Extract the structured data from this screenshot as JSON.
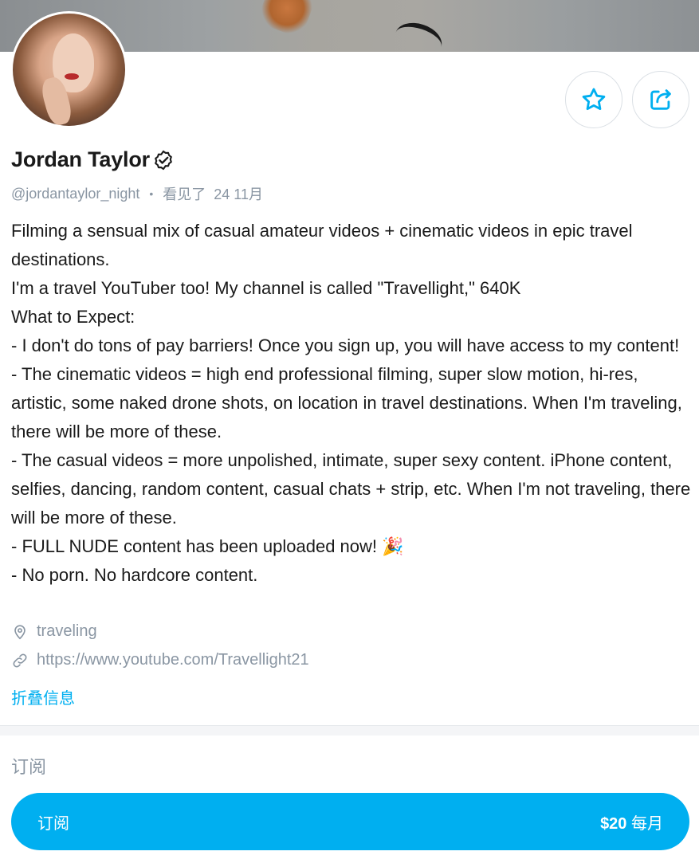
{
  "profile": {
    "name": "Jordan Taylor",
    "handle": "@jordantaylor_night",
    "seen_label": "看见了",
    "seen_date": "24 11月"
  },
  "bio": {
    "lines": [
      "Filming a sensual mix of casual amateur videos + cinematic videos in epic travel destinations.",
      "I'm a travel YouTuber too! My channel is called \"Travellight,\" 640K",
      "What to Expect:",
      "- I don't do tons of pay barriers! Once you sign up, you will have access to my content!",
      "- The cinematic videos = high end professional filming, super slow motion, hi-res, artistic, some naked drone shots, on location in travel destinations. When I'm traveling, there will be more of these.",
      "- The casual videos = more unpolished, intimate, super sexy content. iPhone content, selfies, dancing, random content, casual chats + strip, etc. When I'm not traveling, there will be more of these.",
      "- FULL NUDE content has been uploaded now! 🎉",
      "- No porn. No hardcore content."
    ]
  },
  "info": {
    "location_icon": "location-pin-icon",
    "location": "traveling",
    "link_icon": "link-icon",
    "link": "https://www.youtube.com/Travellight21"
  },
  "collapse_label": "折叠信息",
  "subscription": {
    "section_label": "订阅",
    "button_label": "订阅",
    "price": "$20",
    "period": "每月"
  },
  "icons": {
    "favorite": "star-icon",
    "share": "share-icon",
    "verified": "verified-badge-icon"
  },
  "colors": {
    "accent": "#00aff0",
    "muted_text": "#8a96a3",
    "text": "#1a1a1a"
  }
}
